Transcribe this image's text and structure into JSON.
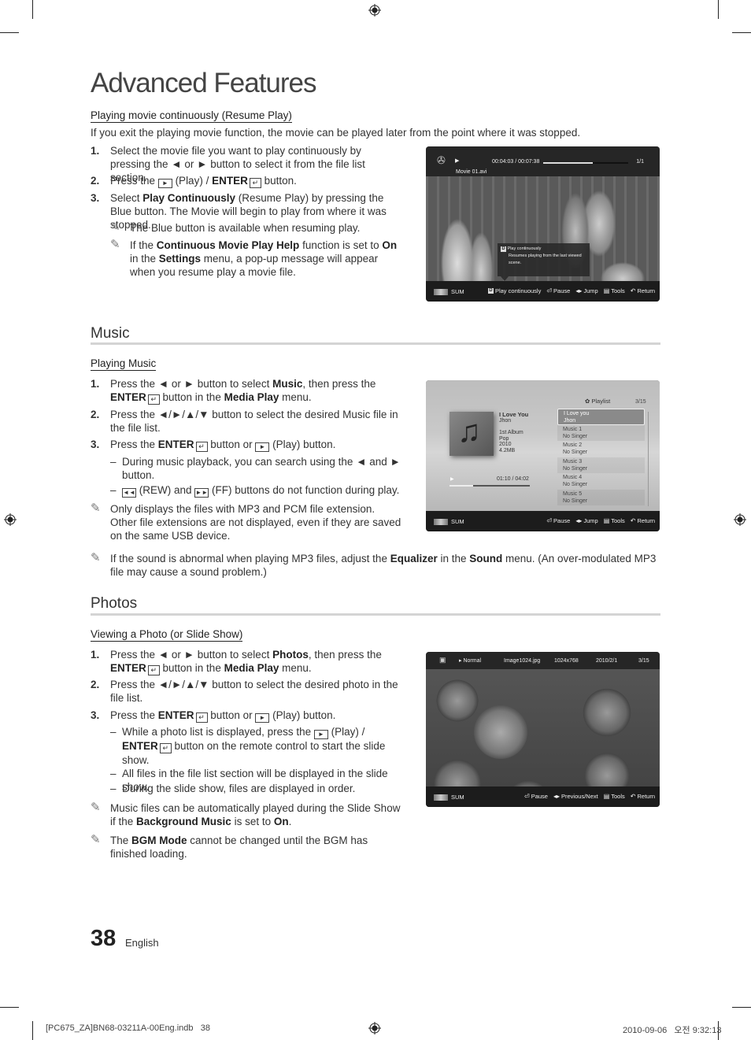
{
  "page": {
    "title": "Advanced Features",
    "page_number": "38",
    "language": "English",
    "footer_file": "[PC675_ZA]BN68-03211A-00Eng.indb   38",
    "footer_timestamp": "2010-09-06   오전 9:32:13"
  },
  "resume": {
    "subheading": "Playing movie continuously (Resume Play)",
    "intro": "If you exit the playing movie function, the movie can be played later from the point where it was stopped.",
    "steps": [
      {
        "num": "1.",
        "text": "Select the movie file you want to play continuously by pressing the ◄ or ► button to select it from the file list section."
      },
      {
        "num": "2.",
        "pre": "Press the",
        "mid": "(Play) / ",
        "bold": "ENTER",
        "post": "button."
      },
      {
        "num": "3.",
        "a": "Select ",
        "b": "Play Continuously",
        "c": " (Resume Play) by pressing the Blue button. The Movie will begin to play from where it was stopped."
      }
    ],
    "notes": [
      {
        "text": "The Blue button is available when resuming play."
      },
      {
        "a": "If the ",
        "b": "Continuous Movie Play Help",
        "c": " function is set to ",
        "d": "On",
        "e": " in the ",
        "f": "Settings",
        "g": " menu, a pop-up message will appear when you resume play a movie file."
      }
    ],
    "screen": {
      "time": "00:04:03 / 00:07:38",
      "progress": 0.58,
      "count": "1/1",
      "filename": "Movie 01.avi",
      "popup_key": "D",
      "popup_title": "Play continuously",
      "popup_text": "Resumes playing from the last viewed scene.",
      "sum": "SUM",
      "controls": [
        {
          "icon": "d-key-icon",
          "label": "Play continuously"
        },
        {
          "icon": "enter-icon",
          "label": "Pause"
        },
        {
          "icon": "left-right-icon",
          "label": "Jump"
        },
        {
          "icon": "tools-icon",
          "label": "Tools"
        },
        {
          "icon": "return-icon",
          "label": "Return"
        }
      ]
    }
  },
  "music": {
    "heading": "Music",
    "subheading": "Playing Music",
    "steps": [
      {
        "num": "1.",
        "a": "Press the ◄ or ► button to select ",
        "b": "Music",
        "c": ", then press the ",
        "d": "ENTER",
        "e": " button in the ",
        "f": "Media Play",
        "g": " menu."
      },
      {
        "num": "2.",
        "text": "Press the ◄/►/▲/▼ button to select the desired Music file in the file list."
      },
      {
        "num": "3.",
        "a": "Press the ",
        "b": "ENTER",
        "c": " button or ",
        "d": "(Play) button."
      }
    ],
    "subitems": [
      {
        "text": "During music playback, you can search using the ◄ and ► button."
      },
      {
        "a": "(REW) and ",
        "b": "(FF) buttons do not function during play."
      }
    ],
    "notes": [
      {
        "text": "Only displays the files with MP3 and PCM file extension. Other file extensions are not displayed, even if they are saved on the same USB device."
      },
      {
        "a": "If the sound is abnormal when playing MP3 files, adjust the ",
        "b": "Equalizer",
        "c": " in the ",
        "d": "Sound",
        "e": " menu. (An over-modulated MP3 file may cause a sound problem.)"
      }
    ],
    "screen": {
      "playlist_label": "Playlist",
      "count": "3/15",
      "song_title": "I Love You",
      "artist": "Jhon",
      "album": "1st Album",
      "genre": "Pop",
      "year": "2010",
      "size": "4.2MB",
      "time": "01:10 / 04:02",
      "progress": 0.29,
      "playlist": [
        {
          "title": "I Love you",
          "artist": "Jhon",
          "selected": true
        },
        {
          "title": "Music 1",
          "artist": "No Singer"
        },
        {
          "title": "Music 2",
          "artist": "No Singer"
        },
        {
          "title": "Music 3",
          "artist": "No Singer"
        },
        {
          "title": "Music 4",
          "artist": "No Singer"
        },
        {
          "title": "Music 5",
          "artist": "No Singer"
        }
      ],
      "sum": "SUM",
      "controls": [
        {
          "icon": "enter-icon",
          "label": "Pause"
        },
        {
          "icon": "left-right-icon",
          "label": "Jump"
        },
        {
          "icon": "tools-icon",
          "label": "Tools"
        },
        {
          "icon": "return-icon",
          "label": "Return"
        }
      ]
    }
  },
  "photos": {
    "heading": "Photos",
    "subheading": "Viewing a Photo (or Slide Show)",
    "steps": [
      {
        "num": "1.",
        "a": "Press the ◄ or ► button to select ",
        "b": "Photos",
        "c": ", then press the ",
        "d": "ENTER",
        "e": " button in the ",
        "f": "Media Play",
        "g": " menu."
      },
      {
        "num": "2.",
        "text": "Press the ◄/►/▲/▼ button to select the desired photo in the file list."
      },
      {
        "num": "3.",
        "a": "Press the ",
        "b": "ENTER",
        "c": " button or ",
        "d": "(Play) button."
      }
    ],
    "subitems": [
      {
        "a": "While a photo list is displayed, press the ",
        "b": "(Play) / ",
        "c": "ENTER",
        "d": " button on the remote control to start the slide show."
      },
      {
        "text": "All files in the file list section will be displayed in the slide show."
      },
      {
        "text": "During the slide show, files are displayed in order."
      }
    ],
    "notes": [
      {
        "a": "Music files can be automatically played during the Slide Show if the ",
        "b": "Background Music",
        "c": " is set to ",
        "d": "On",
        "e": "."
      },
      {
        "a": "The ",
        "b": "BGM Mode",
        "c": " cannot be changed until the BGM has finished loading."
      }
    ],
    "screen": {
      "mode": "Normal",
      "filename": "Image1024.jpg",
      "resolution": "1024x768",
      "date": "2010/2/1",
      "count": "3/15",
      "sum": "SUM",
      "controls": [
        {
          "icon": "enter-icon",
          "label": "Pause"
        },
        {
          "icon": "left-right-icon",
          "label": "Previous/Next"
        },
        {
          "icon": "tools-icon",
          "label": "Tools"
        },
        {
          "icon": "return-icon",
          "label": "Return"
        }
      ]
    }
  }
}
